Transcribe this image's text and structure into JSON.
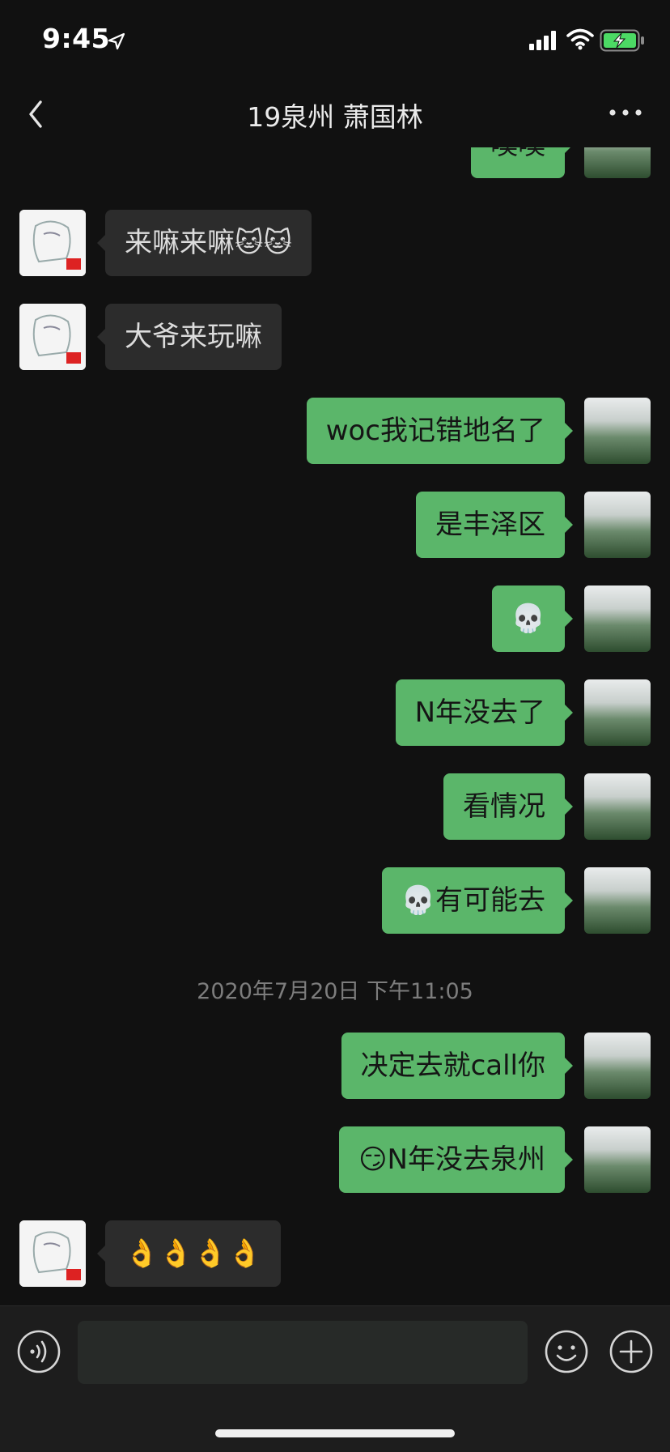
{
  "status_bar": {
    "time": "9:45"
  },
  "nav": {
    "title": "19泉州 萧国林"
  },
  "messages": [
    {
      "text": "噢噢"
    },
    {
      "text": "来嘛来嘛🐱🐱"
    },
    {
      "text": "大爷来玩嘛"
    },
    {
      "text": "woc我记错地名了"
    },
    {
      "text": "是丰泽区"
    },
    {
      "text": "💀"
    },
    {
      "text": "N年没去了"
    },
    {
      "text": "看情况"
    },
    {
      "text": "💀有可能去"
    },
    {
      "text": "决定去就call你"
    },
    {
      "text": "😏N年没去泉州"
    },
    {
      "text": "👌👌👌👌"
    }
  ],
  "timestamp": "2020年7月20日 下午11:05",
  "input": {
    "value": ""
  },
  "colors": {
    "background": "#111111",
    "outgoing_bubble": "#5bb66a",
    "incoming_bubble": "#2c2c2c",
    "battery_charging": "#4cd964"
  }
}
